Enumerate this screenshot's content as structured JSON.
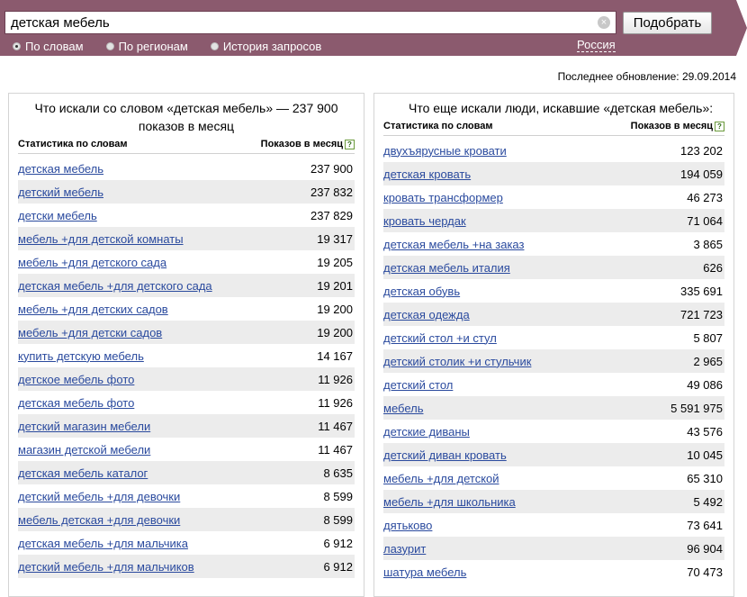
{
  "search": {
    "query": "детская мебель",
    "submit_label": "Подобрать",
    "clear_glyph": "×"
  },
  "modes": [
    {
      "label": "По словам",
      "selected": true
    },
    {
      "label": "По регионам",
      "selected": false
    },
    {
      "label": "История запросов",
      "selected": false
    }
  ],
  "region": "Россия",
  "last_update": "Последнее обновление: 29.09.2014",
  "left": {
    "title": "Что искали со словом «детская мебель» — 237 900 показов в месяц",
    "col_phrase": "Статистика по словам",
    "col_count": "Показов в месяц",
    "help": "?",
    "rows": [
      {
        "phrase": "детская мебель",
        "count": "237 900"
      },
      {
        "phrase": "детский мебель",
        "count": "237 832"
      },
      {
        "phrase": "детски мебель",
        "count": "237 829"
      },
      {
        "phrase": "мебель +для детской комнаты",
        "count": "19 317"
      },
      {
        "phrase": "мебель +для детского сада",
        "count": "19 205"
      },
      {
        "phrase": "детская мебель +для детского сада",
        "count": "19 201"
      },
      {
        "phrase": "мебель +для детских садов",
        "count": "19 200"
      },
      {
        "phrase": "мебель +для детски садов",
        "count": "19 200"
      },
      {
        "phrase": "купить детскую мебель",
        "count": "14 167"
      },
      {
        "phrase": "детское мебель фото",
        "count": "11 926"
      },
      {
        "phrase": "детская мебель фото",
        "count": "11 926"
      },
      {
        "phrase": "детский магазин мебели",
        "count": "11 467"
      },
      {
        "phrase": "магазин детской мебели",
        "count": "11 467"
      },
      {
        "phrase": "детская мебель каталог",
        "count": "8 635"
      },
      {
        "phrase": "детский мебель +для девочки",
        "count": "8 599"
      },
      {
        "phrase": "мебель детская +для девочки",
        "count": "8 599"
      },
      {
        "phrase": "детская мебель +для мальчика",
        "count": "6 912"
      },
      {
        "phrase": "детский мебель +для мальчиков",
        "count": "6 912"
      }
    ]
  },
  "right": {
    "title": "Что еще искали люди, искавшие «детская мебель»:",
    "col_phrase": "Статистика по словам",
    "col_count": "Показов в месяц",
    "help": "?",
    "rows": [
      {
        "phrase": "двухъярусные кровати",
        "count": "123 202"
      },
      {
        "phrase": "детская кровать",
        "count": "194 059"
      },
      {
        "phrase": "кровать трансформер",
        "count": "46 273"
      },
      {
        "phrase": "кровать чердак",
        "count": "71 064"
      },
      {
        "phrase": "детская мебель +на заказ",
        "count": "3 865"
      },
      {
        "phrase": "детская мебель италия",
        "count": "626"
      },
      {
        "phrase": "детская обувь",
        "count": "335 691"
      },
      {
        "phrase": "детская одежда",
        "count": "721 723"
      },
      {
        "phrase": "детский стол +и стул",
        "count": "5 807"
      },
      {
        "phrase": "детский столик +и стульчик",
        "count": "2 965"
      },
      {
        "phrase": "детский стол",
        "count": "49 086"
      },
      {
        "phrase": "мебель",
        "count": "5 591 975"
      },
      {
        "phrase": "детские диваны",
        "count": "43 576"
      },
      {
        "phrase": "детский диван кровать",
        "count": "10 045"
      },
      {
        "phrase": "мебель +для детской",
        "count": "65 310"
      },
      {
        "phrase": "мебель +для школьника",
        "count": "5 492"
      },
      {
        "phrase": "дятьково",
        "count": "73 641"
      },
      {
        "phrase": "лазурит",
        "count": "96 904"
      },
      {
        "phrase": "шатура мебель",
        "count": "70 473"
      }
    ]
  },
  "colors": {
    "header": "#8b5a6e",
    "link": "#2a4a9e",
    "row_alt": "#ececec"
  }
}
